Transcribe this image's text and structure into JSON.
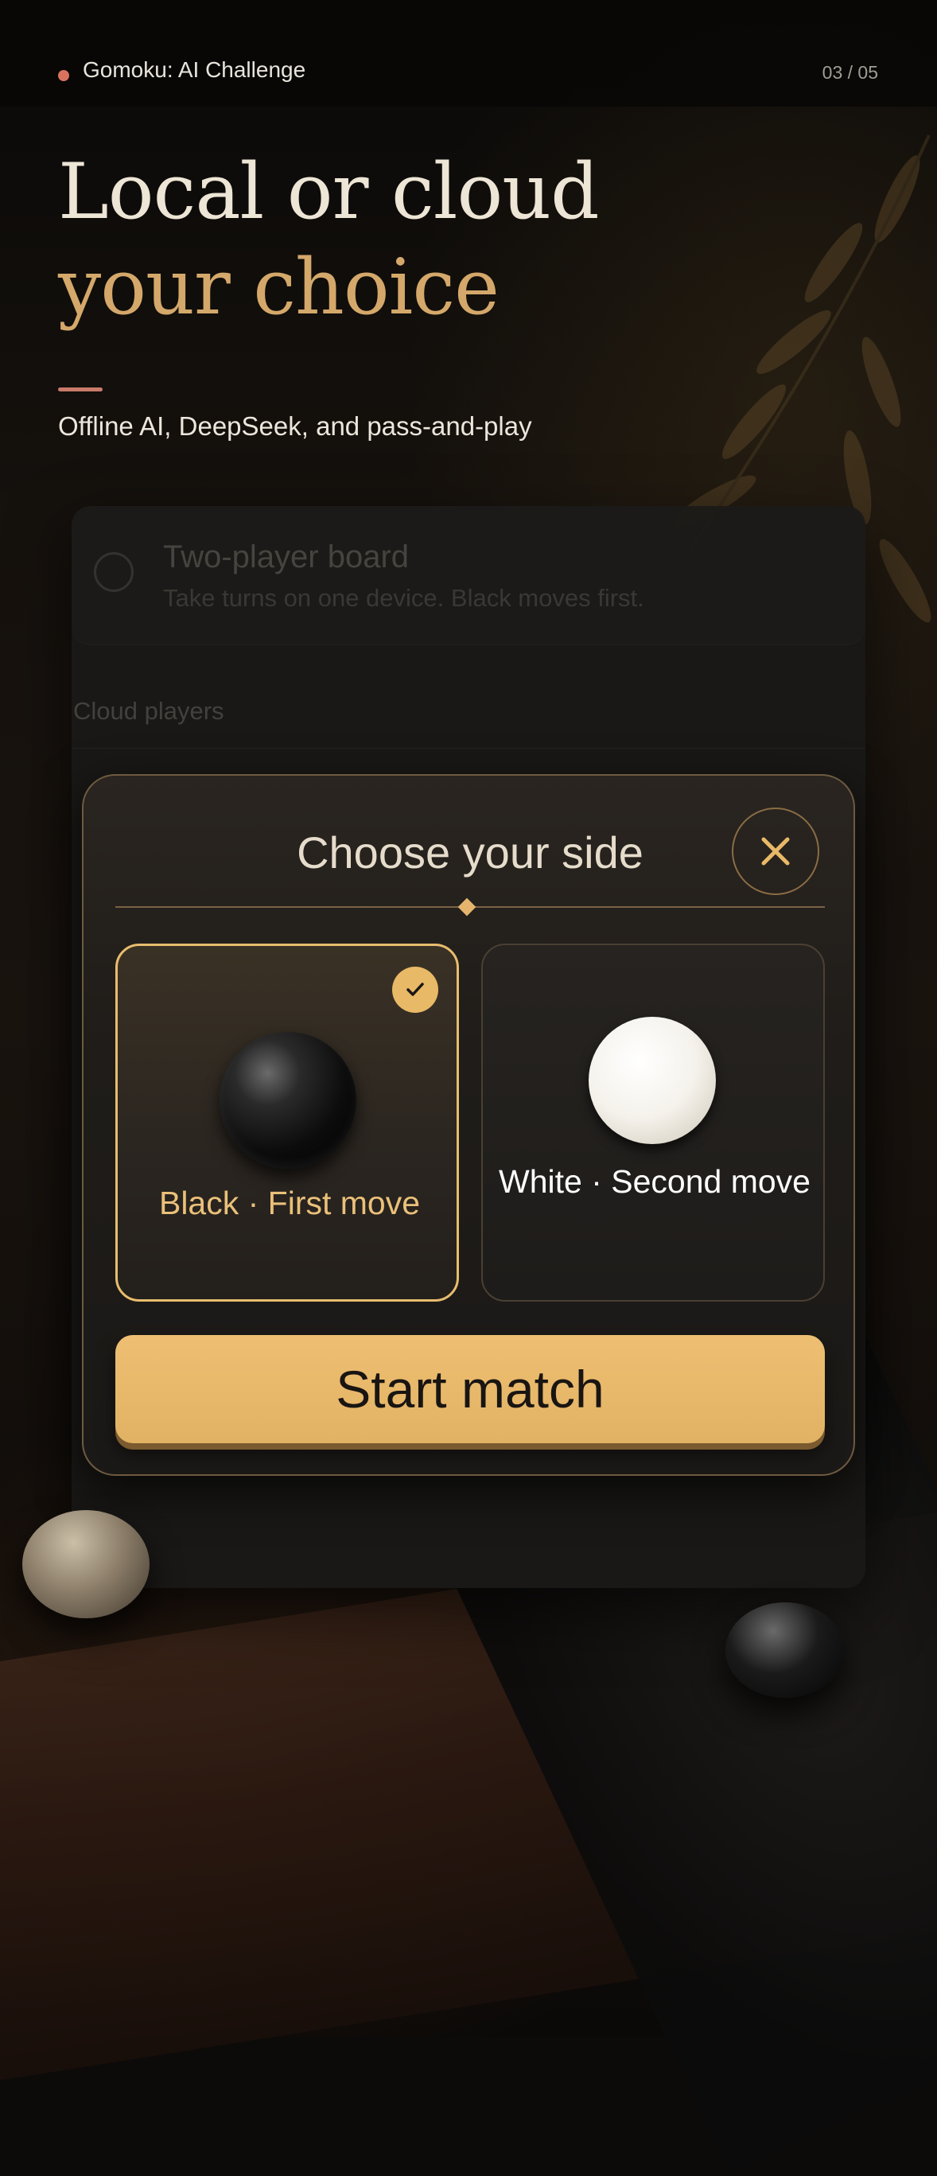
{
  "header": {
    "app_title": "Gomoku: AI Challenge",
    "page_indicator": "03 / 05"
  },
  "hero": {
    "line1": "Local or cloud",
    "line2": "your choice",
    "subtitle": "Offline AI, DeepSeek, and pass-and-play"
  },
  "background_sheet": {
    "option": {
      "title": "Two-player board",
      "description": "Take turns on one device. Black moves first."
    },
    "section_label": "Cloud players"
  },
  "modal": {
    "title": "Choose your side",
    "close_icon": "close-icon",
    "options": [
      {
        "label": "Black · First move",
        "selected": true,
        "stone": "black-stone-icon"
      },
      {
        "label": "White · Second move",
        "selected": false,
        "stone": "white-stone-icon"
      }
    ],
    "start_button": "Start match"
  },
  "colors": {
    "accent_gold": "#e8b967",
    "title_gold": "#d4a86a",
    "accent_coral": "#d9735f",
    "background": "#0d0b09"
  }
}
